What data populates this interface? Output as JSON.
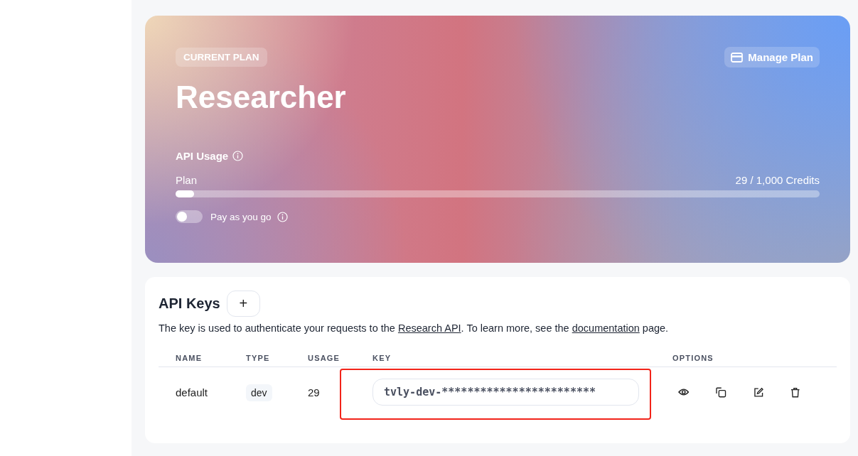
{
  "plan": {
    "badge": "CURRENT PLAN",
    "name": "Researcher",
    "manage_button": "Manage Plan",
    "usage_title": "API Usage",
    "meter_label": "Plan",
    "reading": "29 / 1,000 Credits",
    "level": 0.029,
    "payg": {
      "label": "Pay as you go",
      "on": false
    }
  },
  "api_keys": {
    "title": "API Keys",
    "add_button": "+",
    "description": {
      "before": "The key is used to authenticate your requests to the ",
      "link1": "Research API",
      "middle": ". To learn more, see the ",
      "link2": "documentation",
      "after": " page."
    },
    "columns": [
      "NAME",
      "TYPE",
      "USAGE",
      "KEY",
      "OPTIONS"
    ],
    "rows": [
      {
        "name": "default",
        "type": "dev",
        "usage": "29",
        "key": "tvly-dev-************************",
        "highlighted": true
      }
    ]
  }
}
